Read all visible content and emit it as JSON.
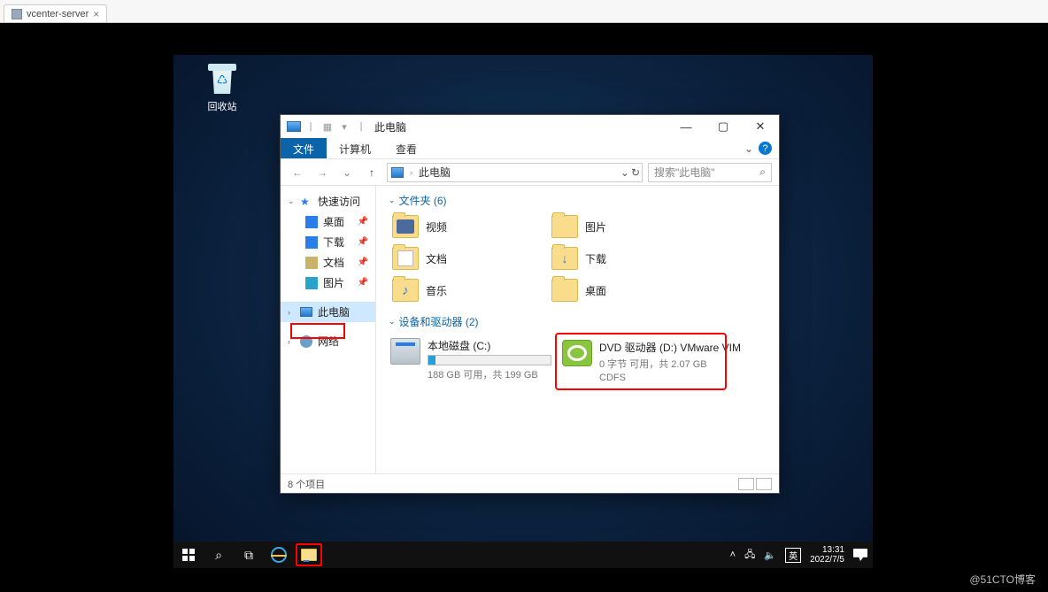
{
  "outer_tab": {
    "label": "vcenter-server"
  },
  "watermark": "@51CTO博客",
  "recycle_label": "回收站",
  "explorer": {
    "title": "此电脑",
    "titlebar_sep": "|",
    "ribbon": {
      "file": "文件",
      "computer": "计算机",
      "view": "查看",
      "expand_symbol": "⌄",
      "help_symbol": "?"
    },
    "nav": {
      "back": "←",
      "forward": "→",
      "dropdown": "⌄",
      "up": "↑",
      "address_root": "此电脑",
      "address_chevron": "›",
      "refresh": "↻",
      "search_placeholder": "搜索\"此电脑\"",
      "drop_v": "⌄"
    },
    "sidebar": {
      "quickaccess": "快速访问",
      "desktop": "桌面",
      "downloads": "下载",
      "documents": "文档",
      "pictures": "图片",
      "thispc": "此电脑",
      "network": "网络"
    },
    "group_folders": {
      "label": "文件夹 (6)",
      "caret": "⌄"
    },
    "folders": {
      "video": "视频",
      "pictures": "图片",
      "documents": "文档",
      "downloads": "下载",
      "music": "音乐",
      "desktop": "桌面"
    },
    "group_drives": {
      "label": "设备和驱动器 (2)",
      "caret": "⌄"
    },
    "drives": {
      "c": {
        "name": "本地磁盘 (C:)",
        "meta": "188 GB 可用，共 199 GB",
        "fill_pct": 6
      },
      "d": {
        "name": "DVD 驱动器 (D:) VMware VIM",
        "meta1": "0 字节 可用，共 2.07 GB",
        "meta2": "CDFS"
      }
    },
    "status": {
      "count": "8 个项目"
    },
    "winbtns": {
      "min": "—",
      "max": "▢",
      "close": "✕"
    }
  },
  "taskbar": {
    "search": "⌕",
    "taskview": "⧉",
    "tray": {
      "up": "˄",
      "net": "🖧",
      "vol": "🔈",
      "ime": "英",
      "time": "13:31",
      "date": "2022/7/5"
    }
  }
}
